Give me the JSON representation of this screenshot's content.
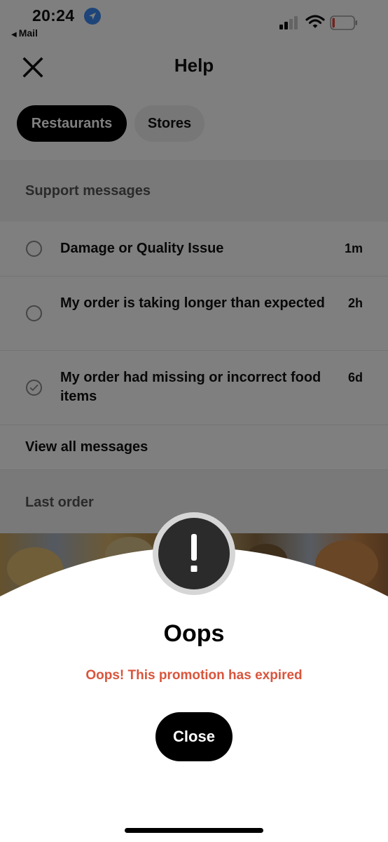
{
  "status_bar": {
    "time": "20:24",
    "back_app": "Mail",
    "back_arrow": "◀",
    "location_icon": "location-arrow-icon",
    "signal_icon": "cellular-signal-icon",
    "wifi_icon": "wifi-icon",
    "battery_icon": "battery-low-icon",
    "battery_level": 0.12,
    "battery_color": "#e5473c"
  },
  "header": {
    "title": "Help",
    "close_icon": "close-icon"
  },
  "tabs": [
    {
      "label": "Restaurants",
      "selected": true
    },
    {
      "label": "Stores",
      "selected": false
    }
  ],
  "support": {
    "heading": "Support messages",
    "messages": [
      {
        "text": "Damage or Quality Issue",
        "time": "1m",
        "status": "open"
      },
      {
        "text": "My order is taking longer than expected",
        "time": "2h",
        "status": "open"
      },
      {
        "text": "My order had missing or incorrect food items",
        "time": "6d",
        "status": "resolved"
      }
    ],
    "view_all": "View all messages"
  },
  "last_order": {
    "heading": "Last order"
  },
  "dialog": {
    "icon": "exclamation-icon",
    "icon_glyph": "!",
    "title": "Oops",
    "message": "Oops! This promotion has expired",
    "message_color": "#d9553c",
    "close_label": "Close"
  }
}
